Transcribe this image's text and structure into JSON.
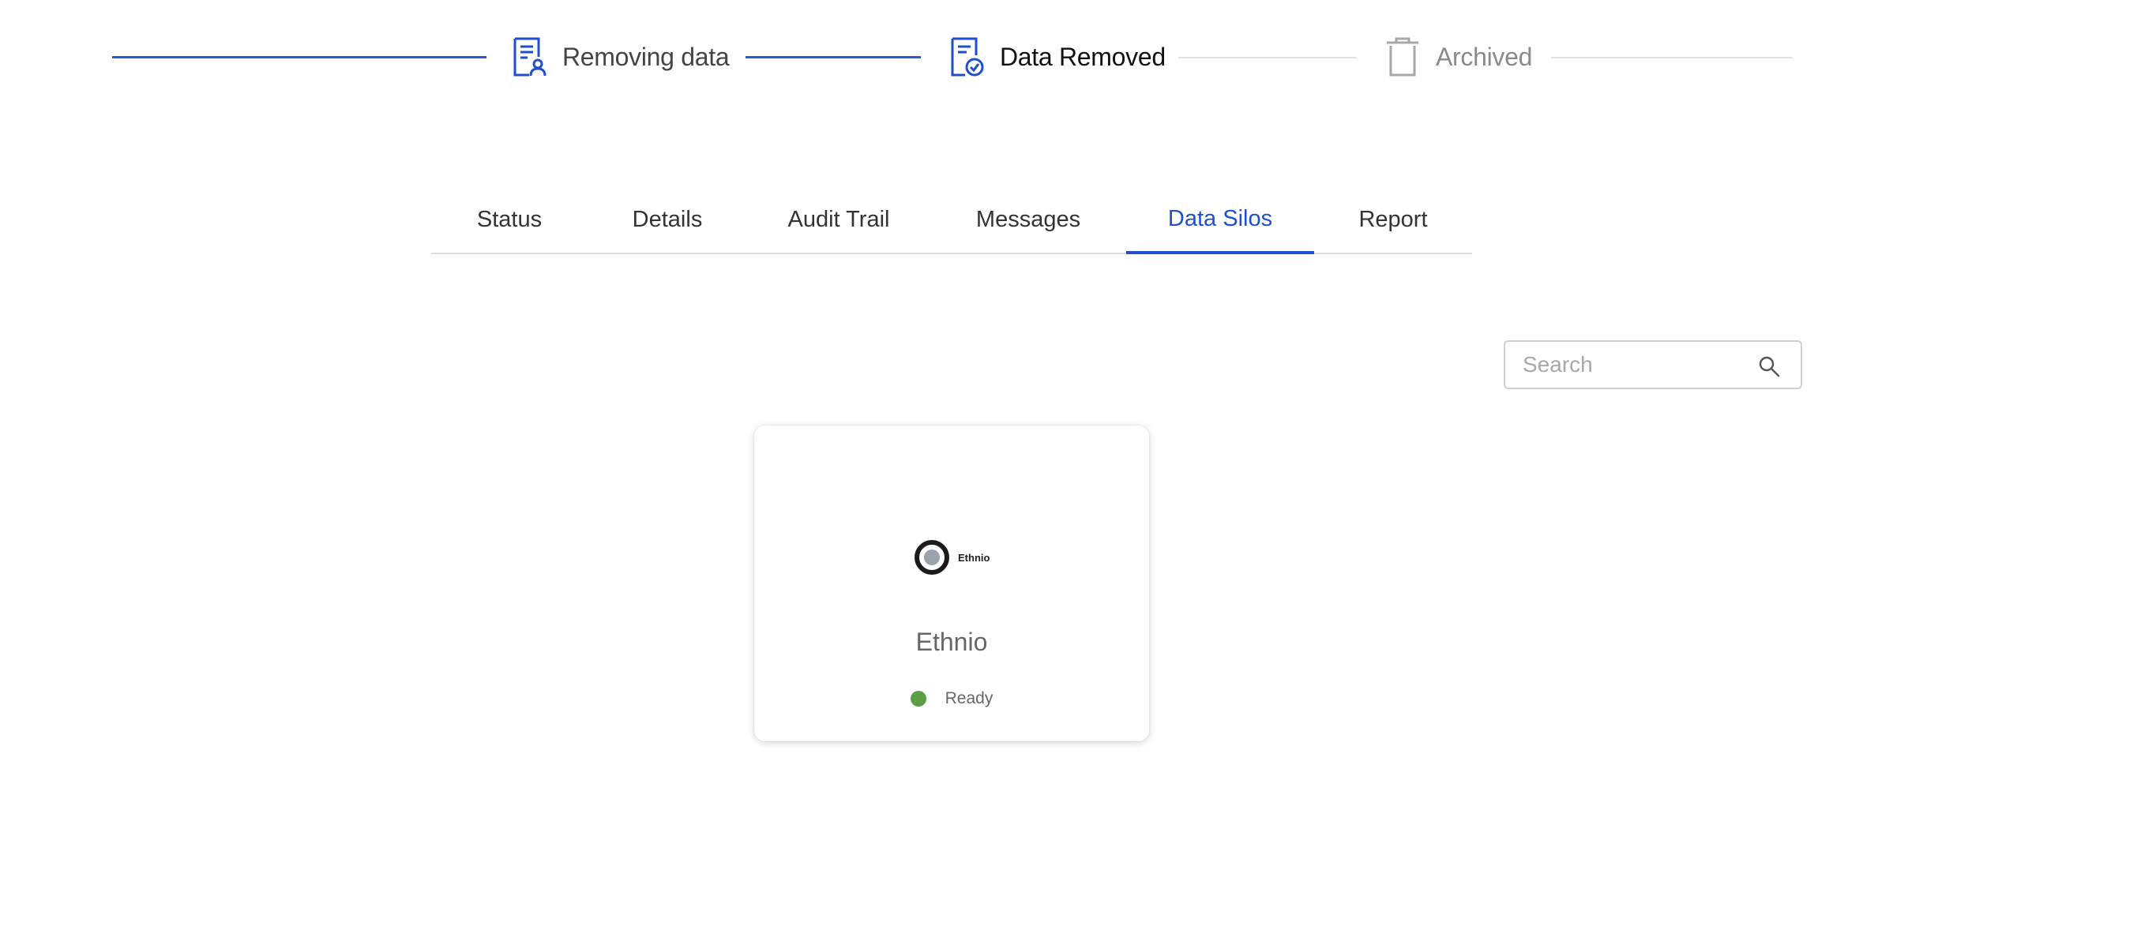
{
  "stepper": {
    "steps": [
      {
        "label": "Removing data",
        "state": "completed",
        "icon": "document-user-icon"
      },
      {
        "label": "Data Removed",
        "state": "current",
        "icon": "document-check-icon"
      },
      {
        "label": "Archived",
        "state": "upcoming",
        "icon": "trash-icon"
      }
    ]
  },
  "tabs": [
    {
      "label": "Status",
      "active": false
    },
    {
      "label": "Details",
      "active": false
    },
    {
      "label": "Audit Trail",
      "active": false
    },
    {
      "label": "Messages",
      "active": false
    },
    {
      "label": "Data Silos",
      "active": true
    },
    {
      "label": "Report",
      "active": false
    }
  ],
  "search": {
    "placeholder": "Search",
    "value": "",
    "icon": "search-icon"
  },
  "silos": [
    {
      "logo_text": "Ethnio",
      "name": "Ethnio",
      "status": "Ready",
      "status_color": "#5a9e46"
    }
  ],
  "colors": {
    "accent": "#1f4fd0",
    "completed_line": "#2a5ad6",
    "inactive_line": "#e2e2e2",
    "ready": "#5a9e46"
  }
}
